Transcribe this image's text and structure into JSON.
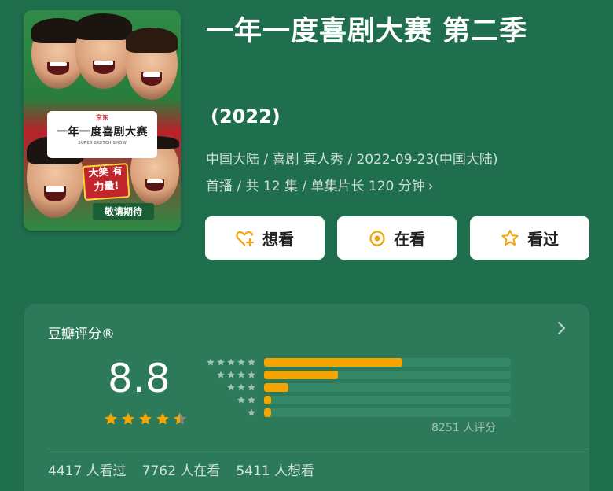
{
  "colors": {
    "background": "#1f6e4e",
    "card": "#2d7a5b",
    "bar_fill": "#f5a400",
    "button_bg": "#ffffff",
    "icon_orange": "#f5a400"
  },
  "poster": {
    "logo": "京东",
    "title": "一年一度喜剧大赛",
    "subtitle": "SUPER SKETCH SHOW",
    "burst": "大笑 有力量!",
    "tag": "敬请期待"
  },
  "title": "一年一度喜剧大赛 第二季",
  "year": "(2022)",
  "meta": {
    "line1": "中国大陆 / 喜剧 真人秀 / 2022-09-23(中国大陆)",
    "line2": "首播 / 共 12 集 / 单集片长 120 分钟",
    "chevron": "›"
  },
  "buttons": {
    "want": {
      "label": "想看",
      "icon": "heart-plus-icon"
    },
    "watching": {
      "label": "在看",
      "icon": "target-icon"
    },
    "watched": {
      "label": "看过",
      "icon": "star-icon"
    }
  },
  "rating": {
    "header": "豆瓣评分®",
    "score": "8.8",
    "stars": 4.5,
    "distribution": [
      {
        "stars": 5,
        "percent": 0.56
      },
      {
        "stars": 4,
        "percent": 0.3
      },
      {
        "stars": 3,
        "percent": 0.1
      },
      {
        "stars": 2,
        "percent": 0.03
      },
      {
        "stars": 1,
        "percent": 0.03
      }
    ],
    "count_text": "8251 人评分"
  },
  "stats": {
    "watched": "4417 人看过",
    "watching": "7762 人在看",
    "want": "5411 人想看"
  }
}
